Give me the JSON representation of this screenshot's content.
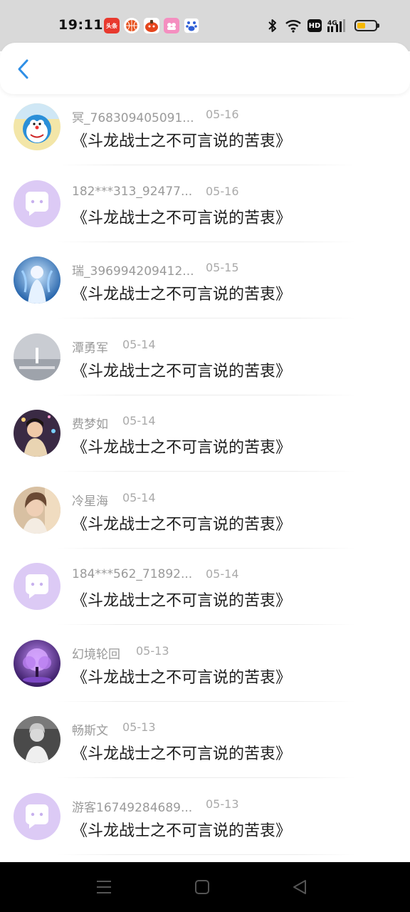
{
  "status_bar": {
    "time": "19:11",
    "notification_badge_text": "头条",
    "battery_level": 0.45
  },
  "header": {
    "back_icon": "chevron-left-icon",
    "accent_color": "#2f8fe6"
  },
  "items": [
    {
      "username": "冥_768309405091...",
      "date": "05-16",
      "title": "《斗龙战士之不可言说的苦衷》",
      "avatar": "doraemon"
    },
    {
      "username": "182***313_92477...",
      "date": "05-16",
      "title": "《斗龙战士之不可言说的苦衷》",
      "avatar": "default-chat"
    },
    {
      "username": "瑞_396994209412...",
      "date": "05-15",
      "title": "《斗龙战士之不可言说的苦衷》",
      "avatar": "anime-blue"
    },
    {
      "username": "潭勇军",
      "date": "05-14",
      "title": "《斗龙战士之不可言说的苦衷》",
      "avatar": "photo-gray"
    },
    {
      "username": "费梦如",
      "date": "05-14",
      "title": "《斗龙战士之不可言说的苦衷》",
      "avatar": "photo-night"
    },
    {
      "username": "冷星海",
      "date": "05-14",
      "title": "《斗龙战士之不可言说的苦衷》",
      "avatar": "photo-warm"
    },
    {
      "username": "184***562_71892...",
      "date": "05-14",
      "title": "《斗龙战士之不可言说的苦衷》",
      "avatar": "default-chat"
    },
    {
      "username": "幻境轮回",
      "date": "05-13",
      "title": "《斗龙战士之不可言说的苦衷》",
      "avatar": "purple-tree"
    },
    {
      "username": "畅斯文",
      "date": "05-13",
      "title": "《斗龙战士之不可言说的苦衷》",
      "avatar": "photo-bw"
    },
    {
      "username": "游客16749284689...",
      "date": "05-13",
      "title": "《斗龙战士之不可言说的苦衷》",
      "avatar": "default-chat"
    }
  ]
}
